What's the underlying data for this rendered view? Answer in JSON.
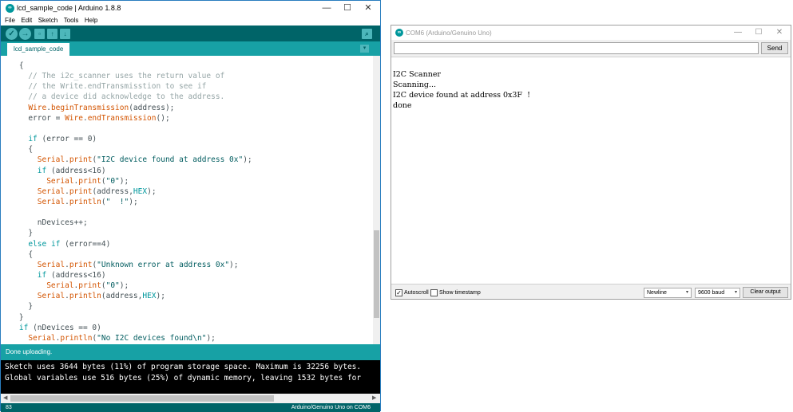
{
  "ide": {
    "title": "lcd_sample_code | Arduino 1.8.8",
    "logo_text": "∞",
    "window_controls": {
      "minimize": "—",
      "maximize": "☐",
      "close": "✕"
    },
    "menu": [
      "File",
      "Edit",
      "Sketch",
      "Tools",
      "Help"
    ],
    "toolbar": {
      "verify": "✓",
      "upload": "→",
      "new": "▫",
      "open": "↑",
      "save": "↓",
      "serial_monitor": "⌕"
    },
    "tab_label": "lcd_sample_code",
    "tab_menu": "▾",
    "code_lines": [
      [
        {
          "t": "    {",
          "c": ""
        }
      ],
      [
        {
          "t": "      // The i2c_scanner uses the return value of",
          "c": "c-comment"
        }
      ],
      [
        {
          "t": "      // the Write.endTransmisstion to see if",
          "c": "c-comment"
        }
      ],
      [
        {
          "t": "      // a device did acknowledge to the address.",
          "c": "c-comment"
        }
      ],
      [
        {
          "t": "      ",
          "c": ""
        },
        {
          "t": "Wire",
          "c": "c-func"
        },
        {
          "t": ".",
          "c": ""
        },
        {
          "t": "beginTransmission",
          "c": "c-func"
        },
        {
          "t": "(address);",
          "c": ""
        }
      ],
      [
        {
          "t": "      error = ",
          "c": ""
        },
        {
          "t": "Wire",
          "c": "c-func"
        },
        {
          "t": ".",
          "c": ""
        },
        {
          "t": "endTransmission",
          "c": "c-func"
        },
        {
          "t": "();",
          "c": ""
        }
      ],
      [
        {
          "t": "",
          "c": ""
        }
      ],
      [
        {
          "t": "      ",
          "c": ""
        },
        {
          "t": "if",
          "c": "c-kw"
        },
        {
          "t": " (error == 0)",
          "c": ""
        }
      ],
      [
        {
          "t": "      {",
          "c": ""
        }
      ],
      [
        {
          "t": "        ",
          "c": ""
        },
        {
          "t": "Serial",
          "c": "c-func"
        },
        {
          "t": ".",
          "c": ""
        },
        {
          "t": "print",
          "c": "c-func"
        },
        {
          "t": "(",
          "c": ""
        },
        {
          "t": "\"I2C device found at address 0x\"",
          "c": "c-str"
        },
        {
          "t": ");",
          "c": ""
        }
      ],
      [
        {
          "t": "        ",
          "c": ""
        },
        {
          "t": "if",
          "c": "c-kw"
        },
        {
          "t": " (address<16)",
          "c": ""
        }
      ],
      [
        {
          "t": "          ",
          "c": ""
        },
        {
          "t": "Serial",
          "c": "c-func"
        },
        {
          "t": ".",
          "c": ""
        },
        {
          "t": "print",
          "c": "c-func"
        },
        {
          "t": "(",
          "c": ""
        },
        {
          "t": "\"0\"",
          "c": "c-str"
        },
        {
          "t": ");",
          "c": ""
        }
      ],
      [
        {
          "t": "        ",
          "c": ""
        },
        {
          "t": "Serial",
          "c": "c-func"
        },
        {
          "t": ".",
          "c": ""
        },
        {
          "t": "print",
          "c": "c-func"
        },
        {
          "t": "(address,",
          "c": ""
        },
        {
          "t": "HEX",
          "c": "c-const"
        },
        {
          "t": ");",
          "c": ""
        }
      ],
      [
        {
          "t": "        ",
          "c": ""
        },
        {
          "t": "Serial",
          "c": "c-func"
        },
        {
          "t": ".",
          "c": ""
        },
        {
          "t": "println",
          "c": "c-func"
        },
        {
          "t": "(",
          "c": ""
        },
        {
          "t": "\"  !\"",
          "c": "c-str"
        },
        {
          "t": ");",
          "c": ""
        }
      ],
      [
        {
          "t": "",
          "c": ""
        }
      ],
      [
        {
          "t": "        nDevices++;",
          "c": ""
        }
      ],
      [
        {
          "t": "      }",
          "c": ""
        }
      ],
      [
        {
          "t": "      ",
          "c": ""
        },
        {
          "t": "else",
          "c": "c-kw"
        },
        {
          "t": " ",
          "c": ""
        },
        {
          "t": "if",
          "c": "c-kw"
        },
        {
          "t": " (error==4)",
          "c": ""
        }
      ],
      [
        {
          "t": "      {",
          "c": ""
        }
      ],
      [
        {
          "t": "        ",
          "c": ""
        },
        {
          "t": "Serial",
          "c": "c-func"
        },
        {
          "t": ".",
          "c": ""
        },
        {
          "t": "print",
          "c": "c-func"
        },
        {
          "t": "(",
          "c": ""
        },
        {
          "t": "\"Unknown error at address 0x\"",
          "c": "c-str"
        },
        {
          "t": ");",
          "c": ""
        }
      ],
      [
        {
          "t": "        ",
          "c": ""
        },
        {
          "t": "if",
          "c": "c-kw"
        },
        {
          "t": " (address<16)",
          "c": ""
        }
      ],
      [
        {
          "t": "          ",
          "c": ""
        },
        {
          "t": "Serial",
          "c": "c-func"
        },
        {
          "t": ".",
          "c": ""
        },
        {
          "t": "print",
          "c": "c-func"
        },
        {
          "t": "(",
          "c": ""
        },
        {
          "t": "\"0\"",
          "c": "c-str"
        },
        {
          "t": ");",
          "c": ""
        }
      ],
      [
        {
          "t": "        ",
          "c": ""
        },
        {
          "t": "Serial",
          "c": "c-func"
        },
        {
          "t": ".",
          "c": ""
        },
        {
          "t": "println",
          "c": "c-func"
        },
        {
          "t": "(address,",
          "c": ""
        },
        {
          "t": "HEX",
          "c": "c-const"
        },
        {
          "t": ");",
          "c": ""
        }
      ],
      [
        {
          "t": "      }",
          "c": ""
        }
      ],
      [
        {
          "t": "    }",
          "c": ""
        }
      ],
      [
        {
          "t": "    ",
          "c": ""
        },
        {
          "t": "if",
          "c": "c-kw"
        },
        {
          "t": " (nDevices == 0)",
          "c": ""
        }
      ],
      [
        {
          "t": "      ",
          "c": ""
        },
        {
          "t": "Serial",
          "c": "c-func"
        },
        {
          "t": ".",
          "c": ""
        },
        {
          "t": "println",
          "c": "c-func"
        },
        {
          "t": "(",
          "c": ""
        },
        {
          "t": "\"No I2C devices found\\n\"",
          "c": "c-str"
        },
        {
          "t": ");",
          "c": ""
        }
      ]
    ],
    "status": "Done uploading.",
    "console_lines": [
      "Sketch uses 3644 bytes (11%) of program storage space. Maximum is 32256 bytes.",
      "Global variables use 516 bytes (25%) of dynamic memory, leaving 1532 bytes for"
    ],
    "scroll_left": "◀",
    "scroll_right": "▶",
    "footer_line": "83",
    "footer_board": "Arduino/Genuino Uno on COM6"
  },
  "monitor": {
    "title": "COM6 (Arduino/Genuino Uno)",
    "logo_text": "∞",
    "window_controls": {
      "minimize": "—",
      "maximize": "☐",
      "close": "✕"
    },
    "input_value": "",
    "send_label": "Send",
    "output_lines": [
      "",
      "I2C Scanner",
      "Scanning...",
      "I2C device found at address 0x3F  !",
      "done"
    ],
    "autoscroll_label": "Autoscroll",
    "autoscroll_checked": "✓",
    "timestamp_label": "Show timestamp",
    "line_ending": "Newline",
    "baud": "9600 baud",
    "select_arrow": "▾",
    "clear_label": "Clear output"
  }
}
